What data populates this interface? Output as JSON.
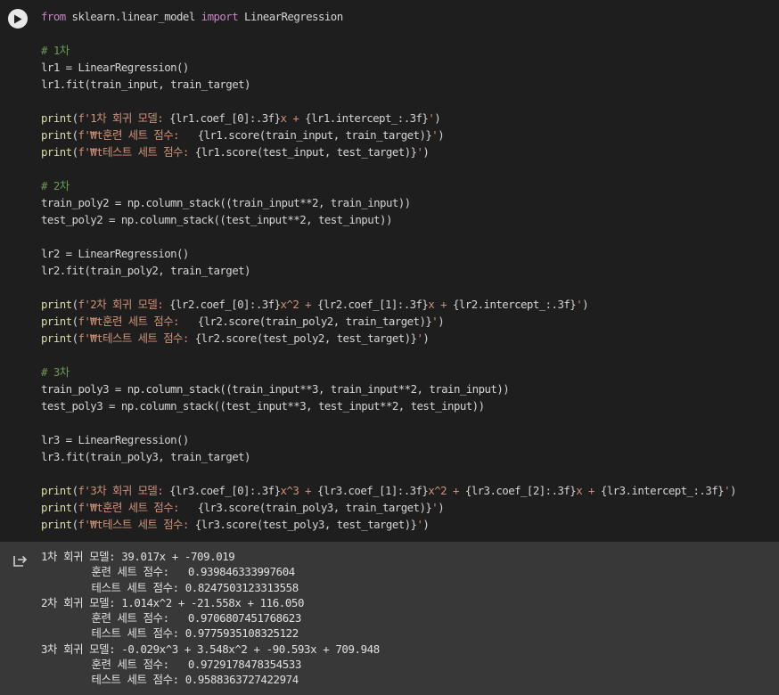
{
  "cell": {
    "code_lines": [
      [
        {
          "t": "from",
          "c": "kw"
        },
        {
          "t": " sklearn.linear_model ",
          "c": "pl"
        },
        {
          "t": "import",
          "c": "kw"
        },
        {
          "t": " LinearRegression",
          "c": "pl"
        }
      ],
      [],
      [
        {
          "t": "# 1차",
          "c": "cm"
        }
      ],
      [
        {
          "t": "lr1 = LinearRegression()",
          "c": "pl"
        }
      ],
      [
        {
          "t": "lr1.fit(train_input, train_target)",
          "c": "pl"
        }
      ],
      [],
      [
        {
          "t": "print",
          "c": "fn"
        },
        {
          "t": "(",
          "c": "pl"
        },
        {
          "t": "f'1차 회귀 모델: ",
          "c": "st"
        },
        {
          "t": "{lr1.coef_[0]:.3f}",
          "c": "pl"
        },
        {
          "t": "x + ",
          "c": "st"
        },
        {
          "t": "{lr1.intercept_:.3f}",
          "c": "pl"
        },
        {
          "t": "'",
          "c": "st"
        },
        {
          "t": ")",
          "c": "pl"
        }
      ],
      [
        {
          "t": "print",
          "c": "fn"
        },
        {
          "t": "(",
          "c": "pl"
        },
        {
          "t": "f'₩t훈련 세트 점수:   ",
          "c": "st"
        },
        {
          "t": "{lr1.score(train_input, train_target)}",
          "c": "pl"
        },
        {
          "t": "'",
          "c": "st"
        },
        {
          "t": ")",
          "c": "pl"
        }
      ],
      [
        {
          "t": "print",
          "c": "fn"
        },
        {
          "t": "(",
          "c": "pl"
        },
        {
          "t": "f'₩t테스트 세트 점수: ",
          "c": "st"
        },
        {
          "t": "{lr1.score(test_input, test_target)}",
          "c": "pl"
        },
        {
          "t": "'",
          "c": "st"
        },
        {
          "t": ")",
          "c": "pl"
        }
      ],
      [],
      [
        {
          "t": "# 2차",
          "c": "cm"
        }
      ],
      [
        {
          "t": "train_poly2 = np.column_stack((train_input**2, train_input))",
          "c": "pl"
        }
      ],
      [
        {
          "t": "test_poly2 = np.column_stack((test_input**2, test_input))",
          "c": "pl"
        }
      ],
      [],
      [
        {
          "t": "lr2 = LinearRegression()",
          "c": "pl"
        }
      ],
      [
        {
          "t": "lr2.fit(train_poly2, train_target)",
          "c": "pl"
        }
      ],
      [],
      [
        {
          "t": "print",
          "c": "fn"
        },
        {
          "t": "(",
          "c": "pl"
        },
        {
          "t": "f'2차 회귀 모델: ",
          "c": "st"
        },
        {
          "t": "{lr2.coef_[0]:.3f}",
          "c": "pl"
        },
        {
          "t": "x^2 + ",
          "c": "st"
        },
        {
          "t": "{lr2.coef_[1]:.3f}",
          "c": "pl"
        },
        {
          "t": "x + ",
          "c": "st"
        },
        {
          "t": "{lr2.intercept_:.3f}",
          "c": "pl"
        },
        {
          "t": "'",
          "c": "st"
        },
        {
          "t": ")",
          "c": "pl"
        }
      ],
      [
        {
          "t": "print",
          "c": "fn"
        },
        {
          "t": "(",
          "c": "pl"
        },
        {
          "t": "f'₩t훈련 세트 점수:   ",
          "c": "st"
        },
        {
          "t": "{lr2.score(train_poly2, train_target)}",
          "c": "pl"
        },
        {
          "t": "'",
          "c": "st"
        },
        {
          "t": ")",
          "c": "pl"
        }
      ],
      [
        {
          "t": "print",
          "c": "fn"
        },
        {
          "t": "(",
          "c": "pl"
        },
        {
          "t": "f'₩t테스트 세트 점수: ",
          "c": "st"
        },
        {
          "t": "{lr2.score(test_poly2, test_target)}",
          "c": "pl"
        },
        {
          "t": "'",
          "c": "st"
        },
        {
          "t": ")",
          "c": "pl"
        }
      ],
      [],
      [
        {
          "t": "# 3차",
          "c": "cm"
        }
      ],
      [
        {
          "t": "train_poly3 = np.column_stack((train_input**3, train_input**2, train_input))",
          "c": "pl"
        }
      ],
      [
        {
          "t": "test_poly3 = np.column_stack((test_input**3, test_input**2, test_input))",
          "c": "pl"
        }
      ],
      [],
      [
        {
          "t": "lr3 = LinearRegression()",
          "c": "pl"
        }
      ],
      [
        {
          "t": "lr3.fit(train_poly3, train_target)",
          "c": "pl"
        }
      ],
      [],
      [
        {
          "t": "print",
          "c": "fn"
        },
        {
          "t": "(",
          "c": "pl"
        },
        {
          "t": "f'3차 회귀 모델: ",
          "c": "st"
        },
        {
          "t": "{lr3.coef_[0]:.3f}",
          "c": "pl"
        },
        {
          "t": "x^3 + ",
          "c": "st"
        },
        {
          "t": "{lr3.coef_[1]:.3f}",
          "c": "pl"
        },
        {
          "t": "x^2 + ",
          "c": "st"
        },
        {
          "t": "{lr3.coef_[2]:.3f}",
          "c": "pl"
        },
        {
          "t": "x + ",
          "c": "st"
        },
        {
          "t": "{lr3.intercept_:.3f}",
          "c": "pl"
        },
        {
          "t": "'",
          "c": "st"
        },
        {
          "t": ")",
          "c": "pl"
        }
      ],
      [
        {
          "t": "print",
          "c": "fn"
        },
        {
          "t": "(",
          "c": "pl"
        },
        {
          "t": "f'₩t훈련 세트 점수:   ",
          "c": "st"
        },
        {
          "t": "{lr3.score(train_poly3, train_target)}",
          "c": "pl"
        },
        {
          "t": "'",
          "c": "st"
        },
        {
          "t": ")",
          "c": "pl"
        }
      ],
      [
        {
          "t": "print",
          "c": "fn"
        },
        {
          "t": "(",
          "c": "pl"
        },
        {
          "t": "f'₩t테스트 세트 점수: ",
          "c": "st"
        },
        {
          "t": "{lr3.score(test_poly3, test_target)}",
          "c": "pl"
        },
        {
          "t": "'",
          "c": "st"
        },
        {
          "t": ")",
          "c": "pl"
        }
      ]
    ],
    "output_lines": [
      "1차 회귀 모델: 39.017x + -709.019",
      "        훈련 세트 점수:   0.939846333997604",
      "        테스트 세트 점수: 0.8247503123313558",
      "2차 회귀 모델: 1.014x^2 + -21.558x + 116.050",
      "        훈련 세트 점수:   0.9706807451768623",
      "        테스트 세트 점수: 0.9775935108325122",
      "3차 회귀 모델: -0.029x^3 + 3.548x^2 + -90.593x + 709.948",
      "        훈련 세트 점수:   0.9729178478354533",
      "        테스트 세트 점수: 0.9588363727422974"
    ]
  },
  "colors": {
    "editor_bg": "#1e1e1e",
    "output_bg": "#383838",
    "keyword": "#c586c0",
    "comment": "#6a9955",
    "string": "#ce9178",
    "function": "#dcdcaa"
  },
  "icons": {
    "run": "play-circle-icon",
    "output": "output-arrow-icon"
  }
}
